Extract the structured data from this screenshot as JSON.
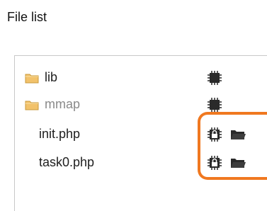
{
  "header": {
    "title": "File list"
  },
  "files": [
    {
      "name": "lib",
      "type": "folder",
      "color": "#1e1e1e"
    },
    {
      "name": "mmap",
      "type": "folder",
      "color": "#8a8a8a"
    },
    {
      "name": "init.php",
      "type": "file",
      "color": "#1e1e1e"
    },
    {
      "name": "task0.php",
      "type": "file",
      "color": "#1e1e1e"
    }
  ],
  "colors": {
    "accent": "#f07820",
    "folder": "#f2c26b"
  },
  "icons": [
    "folder-icon",
    "chip-icon",
    "lock-chip-icon",
    "open-folder-icon"
  ]
}
